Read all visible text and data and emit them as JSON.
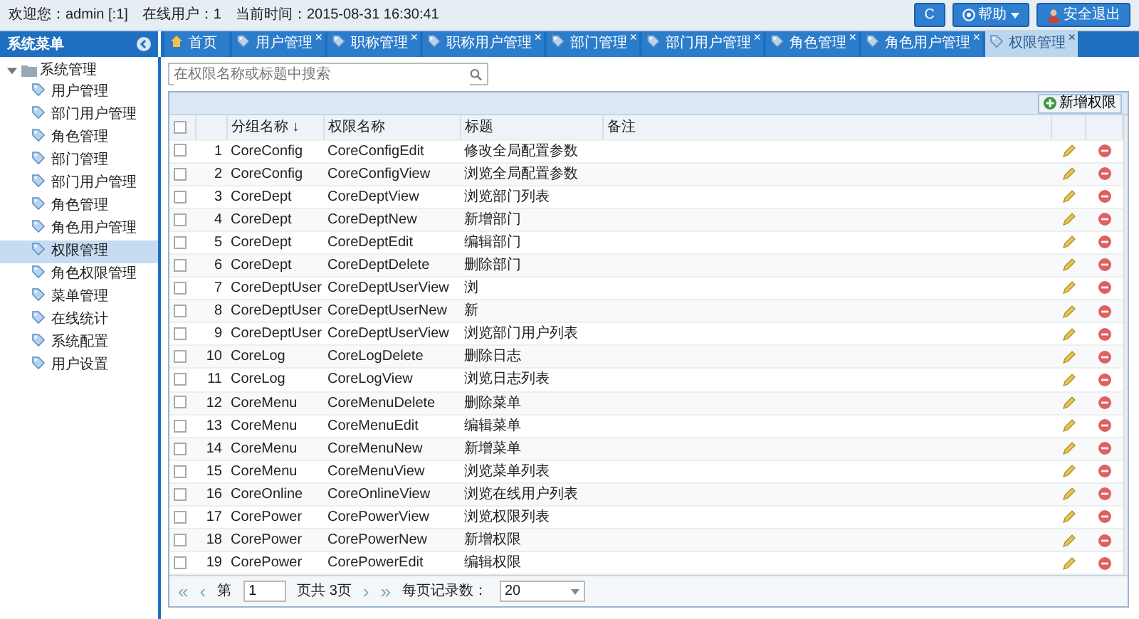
{
  "top_bar": {
    "welcome": "欢迎您：admin [:1]",
    "online": "在线用户：1",
    "time": "当前时间：2015-08-31 16:30:41",
    "buttons": [
      {
        "kind": "refresh",
        "label": "C"
      },
      {
        "kind": "help",
        "label": "帮助"
      },
      {
        "kind": "logout",
        "label": "安全退出"
      }
    ]
  },
  "sidebar": {
    "title": "系统菜单",
    "tree": [
      {
        "label": "系统管理",
        "expanded": true,
        "children": [
          {
            "label": "用户管理",
            "selected": false
          },
          {
            "label": "部门用户管理",
            "selected": false
          },
          {
            "label": "角色管理",
            "selected": false
          },
          {
            "label": "部门管理",
            "selected": false
          },
          {
            "label": "部门用户管理",
            "selected": false
          },
          {
            "label": "角色管理",
            "selected": false
          },
          {
            "label": "角色用户管理",
            "selected": false
          },
          {
            "label": "权限管理",
            "selected": true
          },
          {
            "label": "角色权限管理",
            "selected": false
          },
          {
            "label": "菜单管理",
            "selected": false
          },
          {
            "label": "在线统计",
            "selected": false
          },
          {
            "label": "系统配置",
            "selected": false
          },
          {
            "label": "用户设置",
            "selected": false
          }
        ]
      }
    ]
  },
  "tabs": [
    {
      "kind": "home",
      "label": "首页",
      "selected": false
    },
    {
      "kind": "page",
      "label": "用户管理",
      "selected": false,
      "close": "×"
    },
    {
      "kind": "page",
      "label": "职称管理",
      "selected": false,
      "close": "×"
    },
    {
      "kind": "page",
      "label": "职称用户管理",
      "selected": false,
      "close": "×"
    },
    {
      "kind": "page",
      "label": "部门管理",
      "selected": false,
      "close": "×"
    },
    {
      "kind": "page",
      "label": "部门用户管理",
      "selected": false,
      "close": "×"
    },
    {
      "kind": "page",
      "label": "角色管理",
      "selected": false,
      "close": "×"
    },
    {
      "kind": "page",
      "label": "角色用户管理",
      "selected": false,
      "close": "×"
    },
    {
      "kind": "page",
      "label": "权限管理",
      "selected": true,
      "close": "×"
    }
  ],
  "search": {
    "placeholder": "在权限名称或标题中搜索"
  },
  "toolbar": {
    "add_button": "新增权限"
  },
  "table": {
    "columns": [
      "分组名称 ↓",
      "权限名称",
      "标题",
      "备注"
    ],
    "header_checked": false,
    "rows": [
      {
        "checked": false,
        "number": "1",
        "group": "CoreConfig",
        "name": "CoreConfigEdit",
        "title": "修改全局配置参数"
      },
      {
        "checked": false,
        "number": "2",
        "group": "CoreConfig",
        "name": "CoreConfigView",
        "title": "浏览全局配置参数"
      },
      {
        "checked": false,
        "number": "3",
        "group": "CoreDept",
        "name": "CoreDeptView",
        "title": "浏览部门列表"
      },
      {
        "checked": false,
        "number": "4",
        "group": "CoreDept",
        "name": "CoreDeptNew",
        "title": "新增部门"
      },
      {
        "checked": false,
        "number": "5",
        "group": "CoreDept",
        "name": "CoreDeptEdit",
        "title": "编辑部门"
      },
      {
        "checked": false,
        "number": "6",
        "group": "CoreDept",
        "name": "CoreDeptDelete",
        "title": "删除部门"
      },
      {
        "checked": false,
        "number": "7",
        "group": "CoreDeptUser",
        "name": "CoreDeptUserView",
        "title": "浏"
      },
      {
        "checked": false,
        "number": "8",
        "group": "CoreDeptUser",
        "name": "CoreDeptUserNew",
        "title": "新"
      },
      {
        "checked": false,
        "number": "9",
        "group": "CoreDeptUser",
        "name": "CoreDeptUserView",
        "title": "浏览部门用户列表"
      },
      {
        "checked": false,
        "number": "10",
        "group": "CoreLog",
        "name": "CoreLogDelete",
        "title": "删除日志"
      },
      {
        "checked": false,
        "number": "11",
        "group": "CoreLog",
        "name": "CoreLogView",
        "title": "浏览日志列表"
      },
      {
        "checked": false,
        "number": "12",
        "group": "CoreMenu",
        "name": "CoreMenuDelete",
        "title": "删除菜单"
      },
      {
        "checked": false,
        "number": "13",
        "group": "CoreMenu",
        "name": "CoreMenuEdit",
        "title": "编辑菜单"
      },
      {
        "checked": false,
        "number": "14",
        "group": "CoreMenu",
        "name": "CoreMenuNew",
        "title": "新增菜单"
      },
      {
        "checked": false,
        "number": "15",
        "group": "CoreMenu",
        "name": "CoreMenuView",
        "title": "浏览菜单列表"
      },
      {
        "checked": false,
        "number": "16",
        "group": "CoreOnline",
        "name": "CoreOnlineView",
        "title": "浏览在线用户列表"
      },
      {
        "checked": false,
        "number": "17",
        "group": "CorePower",
        "name": "CorePowerView",
        "title": "浏览权限列表"
      },
      {
        "checked": false,
        "number": "18",
        "group": "CorePower",
        "name": "CorePowerNew",
        "title": "新增权限"
      },
      {
        "checked": false,
        "number": "19",
        "group": "CorePower",
        "name": "CorePowerEdit",
        "title": "编辑权限"
      }
    ]
  },
  "pager": {
    "first": "«",
    "prev": "‹",
    "page_prefix": "第",
    "page": "1",
    "page_suffix": "页共 3页",
    "next": "›",
    "last": "»",
    "size_label": "每页记录数：",
    "size": "20"
  }
}
